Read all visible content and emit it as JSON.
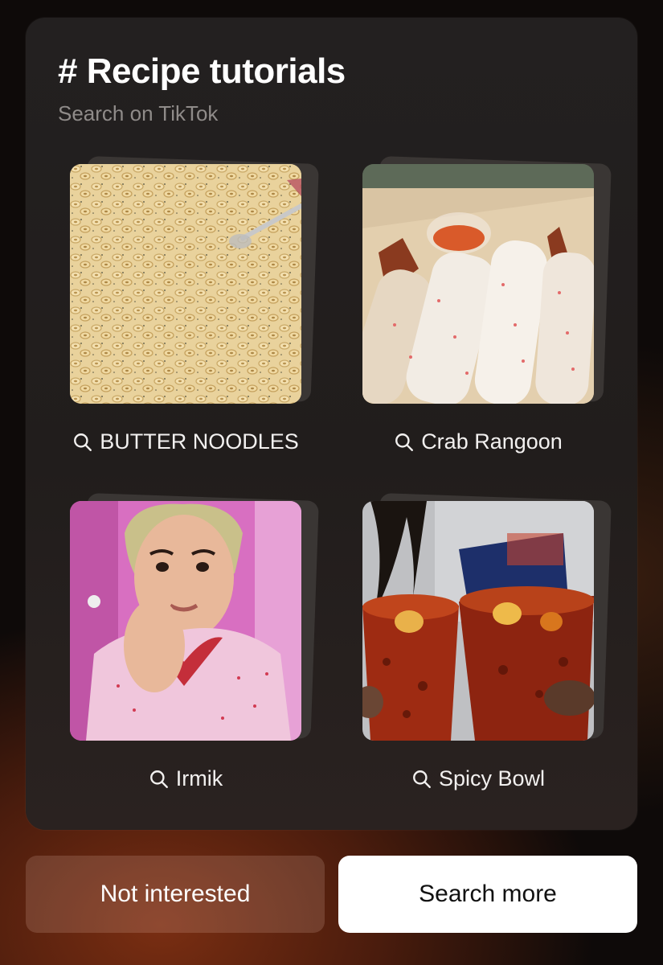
{
  "card": {
    "title": "# Recipe tutorials",
    "subtitle": "Search on TikTok"
  },
  "suggestions": [
    {
      "label": "BUTTER NOODLES",
      "icon": "search-icon",
      "thumbnail": "pasta-photo"
    },
    {
      "label": "Crab Rangoon",
      "icon": "search-icon",
      "thumbnail": "crab-rolls-photo"
    },
    {
      "label": "Irmik",
      "icon": "search-icon",
      "thumbnail": "person-photo"
    },
    {
      "label": "Spicy Bowl",
      "icon": "search-icon",
      "thumbnail": "spicy-cups-photo"
    }
  ],
  "buttons": {
    "not_interested": "Not interested",
    "search_more": "Search more"
  },
  "colors": {
    "card_bg": "#221e1d",
    "text_primary": "#ffffff",
    "text_secondary": "#8f8b89",
    "primary_button_bg": "#ffffff",
    "secondary_button_bg": "#5a3c33"
  }
}
